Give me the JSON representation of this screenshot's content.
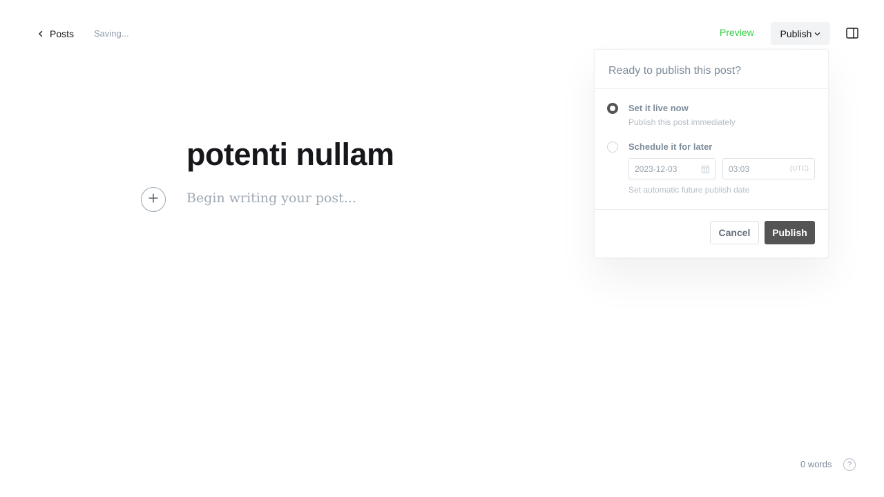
{
  "topbar": {
    "back_label": "Posts",
    "status": "Saving...",
    "preview_label": "Preview",
    "publish_label": "Publish",
    "icons": {
      "back": "chevron-left-icon",
      "publish_dropdown": "chevron-down-icon",
      "sidebar": "sidebar-toggle-icon"
    }
  },
  "editor": {
    "title": "potenti nullam",
    "body_placeholder": "Begin writing your post...",
    "card_menu_icon": "plus-icon"
  },
  "publish_panel": {
    "heading": "Ready to publish this post?",
    "options": [
      {
        "label": "Set it live now",
        "description": "Publish this post immediately",
        "selected": true
      },
      {
        "label": "Schedule it for later",
        "description": "Set automatic future publish date",
        "selected": false
      }
    ],
    "schedule": {
      "date": "2023-12-03",
      "time": "03:03",
      "timezone": "(UTC)",
      "calendar_icon": "calendar-icon"
    },
    "cancel_label": "Cancel",
    "confirm_label": "Publish"
  },
  "footer": {
    "word_count": "0 words",
    "help_icon": "help-icon",
    "help_glyph": "?"
  },
  "colors": {
    "accent_green": "#30cf43",
    "publish_button": "#545454"
  }
}
